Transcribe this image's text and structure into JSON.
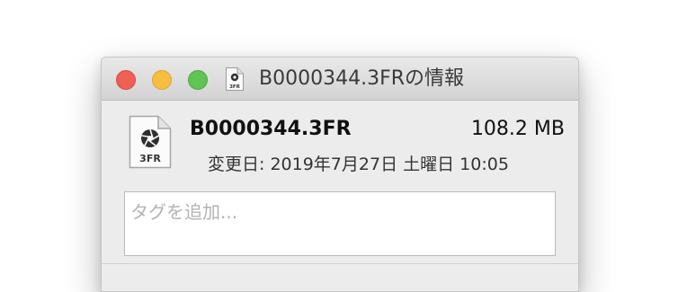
{
  "window": {
    "title": "B0000344.3FRの情報",
    "title_icon": "raw-camera-file-icon"
  },
  "file": {
    "icon": "raw-camera-file-icon",
    "icon_label": "3FR",
    "name": "B0000344.3FR",
    "size": "108.2 MB",
    "modified_label": "変更日:",
    "modified_value": "2019年7月27日 土曜日 10:05"
  },
  "tags": {
    "placeholder": "タグを追加..."
  },
  "colors": {
    "close": "#ee5f58",
    "minimize": "#f6bd3f",
    "zoom": "#5fc454",
    "window_bg": "#ececec"
  }
}
